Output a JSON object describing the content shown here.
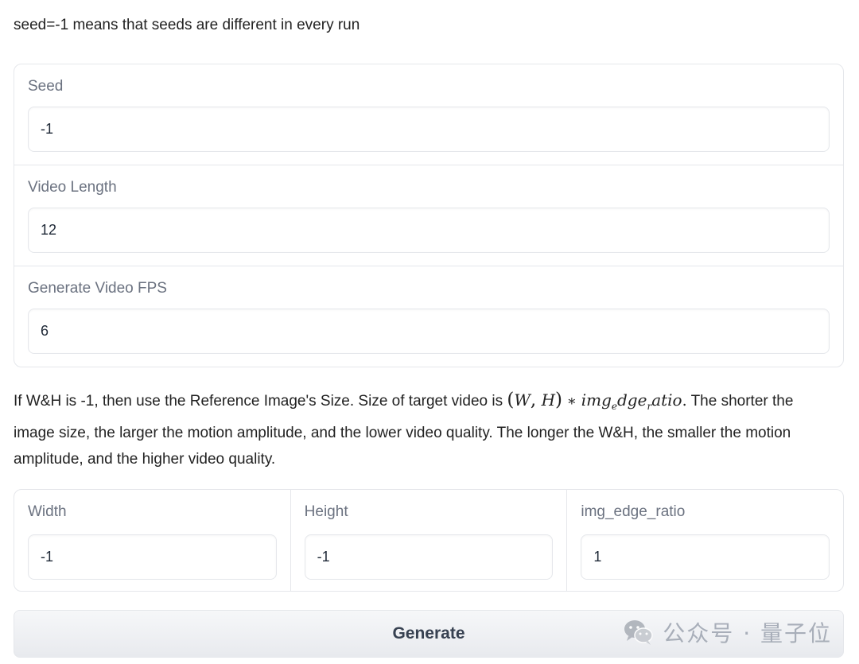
{
  "note": "seed=-1 means that seeds are different in every run",
  "fields": [
    {
      "label": "Seed",
      "value": "-1"
    },
    {
      "label": "Video Length",
      "value": "12"
    },
    {
      "label": "Generate Video FPS",
      "value": "6"
    }
  ],
  "description": {
    "before": "If W&H is -1, then use the Reference Image's Size. Size of target video is ",
    "math": {
      "open": "(",
      "w": "W",
      "comma": ",",
      "h": "H",
      "close": ")",
      "op": " ∗ ",
      "t1": "img",
      "s1": "e",
      "t2": "dge",
      "s2": "r",
      "t3": "atio",
      "dot": "."
    },
    "after": " The shorter the image size, the larger the motion amplitude, and the lower video quality. The longer the W&H, the smaller the motion amplitude, and the higher video quality."
  },
  "size_fields": [
    {
      "label": "Width",
      "value": "-1"
    },
    {
      "label": "Height",
      "value": "-1"
    },
    {
      "label": "img_edge_ratio",
      "value": "1"
    }
  ],
  "generate_label": "Generate",
  "watermark": {
    "icon": "wechat-icon",
    "text": "公众号 · 量子位"
  }
}
